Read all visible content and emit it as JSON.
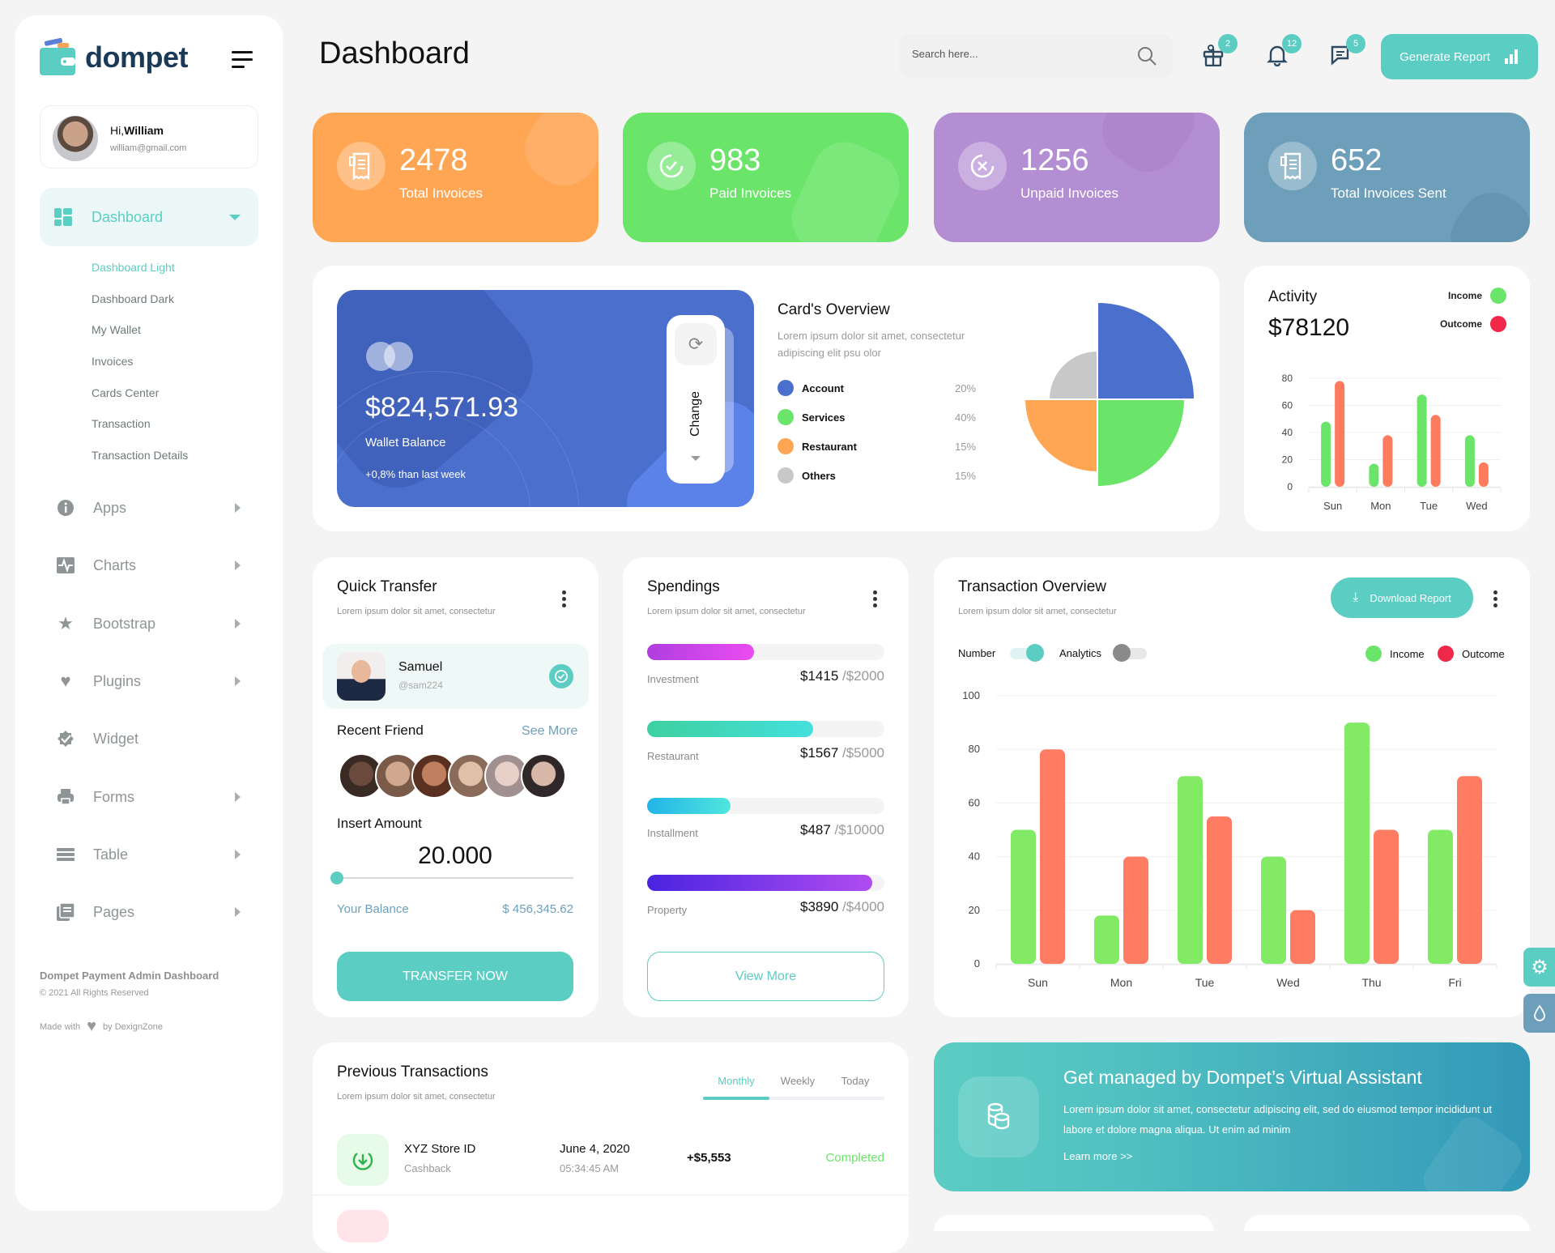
{
  "brand": {
    "name": "dompet"
  },
  "profile": {
    "greeting": "Hi,",
    "name": "William",
    "email": "william@gmail.com"
  },
  "sidebar": {
    "active": {
      "label": "Dashboard",
      "icon": "grid-icon"
    },
    "submenu": [
      "Dashboard Light",
      "Dashboard Dark",
      "My Wallet",
      "Invoices",
      "Cards Center",
      "Transaction",
      "Transaction Details"
    ],
    "items": [
      {
        "label": "Apps",
        "icon": "info-icon",
        "has_arrow": true
      },
      {
        "label": "Charts",
        "icon": "pulse-chart-icon",
        "has_arrow": true
      },
      {
        "label": "Bootstrap",
        "icon": "star-icon",
        "has_arrow": true
      },
      {
        "label": "Plugins",
        "icon": "heart-icon",
        "has_arrow": true
      },
      {
        "label": "Widget",
        "icon": "badge-check-icon",
        "has_arrow": false
      },
      {
        "label": "Forms",
        "icon": "printer-icon",
        "has_arrow": true
      },
      {
        "label": "Table",
        "icon": "table-icon",
        "has_arrow": true
      },
      {
        "label": "Pages",
        "icon": "pages-icon",
        "has_arrow": true
      }
    ],
    "footer": {
      "title": "Dompet Payment Admin Dashboard",
      "copyright": "© 2021 All Rights Reserved",
      "made_with": "Made with",
      "by": "by DexignZone"
    }
  },
  "header": {
    "title": "Dashboard",
    "search_placeholder": "Search here...",
    "badges": {
      "gift": "2",
      "bell": "12",
      "chat": "5"
    },
    "generate_report": "Generate Report"
  },
  "stats": [
    {
      "value": "2478",
      "label": "Total Invoices",
      "color": "#ffa654",
      "icon": "receipt-icon"
    },
    {
      "value": "983",
      "label": "Paid Invoices",
      "color": "#6ae56a",
      "icon": "check-circle-icon"
    },
    {
      "value": "1256",
      "label": "Unpaid Invoices",
      "color": "#b48ed3",
      "icon": "x-circle-icon"
    },
    {
      "value": "652",
      "label": "Total Invoices Sent",
      "color": "#6e9fba",
      "icon": "receipt-icon"
    }
  ],
  "wallet": {
    "balance": "$824,571.93",
    "label": "Wallet Balance",
    "change": "+0,8% than last week",
    "change_button": "Change"
  },
  "cards_overview": {
    "title": "Card's Overview",
    "subtitle": "Lorem ipsum dolor sit amet, consectetur adipiscing elit psu olor",
    "items": [
      {
        "name": "Account",
        "pct": "20%",
        "color": "#4a6fcd"
      },
      {
        "name": "Services",
        "pct": "40%",
        "color": "#6ae56a"
      },
      {
        "name": "Restaurant",
        "pct": "15%",
        "color": "#ffa654"
      },
      {
        "name": "Others",
        "pct": "15%",
        "color": "#c8c8c8"
      }
    ]
  },
  "activity": {
    "title": "Activity",
    "amount": "$78120",
    "legend": [
      {
        "name": "Income",
        "color": "#6ae56a"
      },
      {
        "name": "Outcome",
        "color": "#f0284a"
      }
    ]
  },
  "quick_transfer": {
    "title": "Quick Transfer",
    "subtitle": "Lorem ipsum dolor sit amet, consectetur",
    "selected": {
      "name": "Samuel",
      "handle": "@sam224"
    },
    "recent_title": "Recent Friend",
    "see_more": "See More",
    "insert_amount_label": "Insert Amount",
    "amount": "20.000",
    "slider_fraction": 0,
    "balance_label": "Your Balance",
    "balance": "$ 456,345.62",
    "button": "TRANSFER NOW"
  },
  "spendings": {
    "title": "Spendings",
    "subtitle": "Lorem ipsum dolor sit amet, consectetur",
    "items": [
      {
        "label": "Investment",
        "value": "$1415",
        "limit": "/$2000",
        "fraction": 0.45,
        "from": "#b03ee0",
        "to": "#ea4cf0"
      },
      {
        "label": "Restaurant",
        "value": "$1567",
        "limit": "/$5000",
        "fraction": 0.7,
        "from": "#3ed0a0",
        "to": "#44e0dd"
      },
      {
        "label": "Installment",
        "value": "$487",
        "limit": "/$10000",
        "fraction": 0.35,
        "from": "#22b4e8",
        "to": "#4fe6dd"
      },
      {
        "label": "Property",
        "value": "$3890",
        "limit": "/$4000",
        "fraction": 0.95,
        "from": "#4a24e0",
        "to": "#b04cf0"
      }
    ],
    "view_more": "View More"
  },
  "transaction_overview": {
    "title": "Transaction Overview",
    "subtitle": "Lorem ipsum dolor sit amet, consectetur",
    "download": "Download Report",
    "toggles": [
      {
        "label": "Number",
        "on": true
      },
      {
        "label": "Analytics",
        "on": false
      }
    ],
    "legend": [
      {
        "name": "Income",
        "color": "#6ae56a"
      },
      {
        "name": "Outcome",
        "color": "#f0284a"
      }
    ]
  },
  "previous_transactions": {
    "title": "Previous Transactions",
    "subtitle": "Lorem ipsum dolor sit amet, consectetur",
    "tabs": [
      "Monthly",
      "Weekly",
      "Today"
    ],
    "active_tab": "Monthly",
    "rows": [
      {
        "name": "XYZ Store ID",
        "type": "Cashback",
        "date": "June 4, 2020",
        "time": "05:34:45 AM",
        "amount": "+$5,553",
        "status": "Completed"
      }
    ]
  },
  "assistant": {
    "title": "Get managed by Dompet’s Virtual Assistant",
    "body": "Lorem ipsum dolor sit amet, consectetur adipiscing elit, sed do eiusmod tempor incididunt ut labore et dolore magna aliqua. Ut enim ad minim",
    "link": "Learn more >>"
  },
  "chart_data": [
    {
      "type": "pie",
      "title": "Card's Overview",
      "categories": [
        "Account",
        "Services",
        "Restaurant",
        "Others"
      ],
      "values": [
        20,
        40,
        15,
        15
      ],
      "colors": [
        "#4a6fcd",
        "#6ae56a",
        "#ffa654",
        "#c8c8c8"
      ]
    },
    {
      "type": "bar",
      "title": "Activity",
      "categories": [
        "Sun",
        "Mon",
        "Tue",
        "Wed"
      ],
      "series": [
        {
          "name": "Income",
          "values": [
            48,
            17,
            68,
            38
          ],
          "color": "#6ae56a"
        },
        {
          "name": "Outcome",
          "values": [
            78,
            38,
            53,
            18
          ],
          "color": "#ff7b5e"
        }
      ],
      "ylim": [
        0,
        80
      ],
      "yticks": [
        0,
        20,
        40,
        60,
        80
      ],
      "grid": true
    },
    {
      "type": "bar",
      "title": "Transaction Overview",
      "categories": [
        "Sun",
        "Mon",
        "Tue",
        "Wed",
        "Thu",
        "Fri"
      ],
      "series": [
        {
          "name": "Income",
          "values": [
            50,
            18,
            70,
            40,
            90,
            50
          ],
          "color": "#82ea64"
        },
        {
          "name": "Outcome",
          "values": [
            80,
            40,
            55,
            20,
            50,
            70
          ],
          "color": "#ff7b62"
        }
      ],
      "ylim": [
        0,
        100
      ],
      "yticks": [
        0,
        20,
        40,
        60,
        80,
        100
      ],
      "grid": true,
      "legend": "top-right"
    }
  ]
}
